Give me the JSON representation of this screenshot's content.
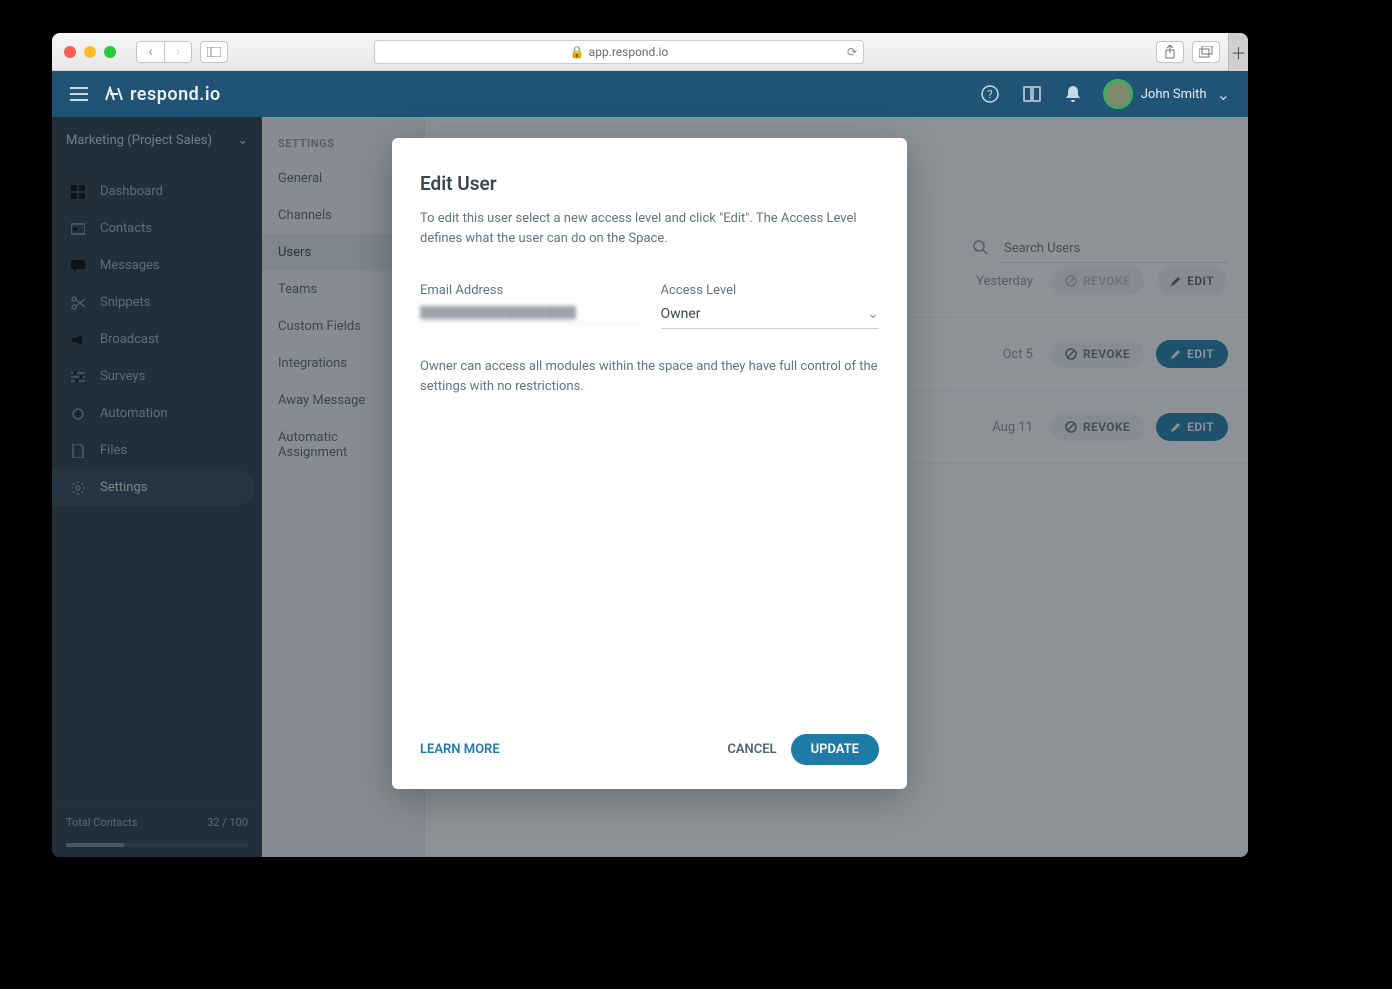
{
  "browser": {
    "url": "app.respond.io"
  },
  "header": {
    "logo_text": "respond.io",
    "user_name": "John Smith"
  },
  "workspace": {
    "name": "Marketing (Project Sales)"
  },
  "nav": {
    "items": [
      {
        "label": "Dashboard",
        "icon": "grid"
      },
      {
        "label": "Contacts",
        "icon": "id"
      },
      {
        "label": "Messages",
        "icon": "chat"
      },
      {
        "label": "Snippets",
        "icon": "scissors"
      },
      {
        "label": "Broadcast",
        "icon": "megaphone"
      },
      {
        "label": "Surveys",
        "icon": "sliders"
      },
      {
        "label": "Automation",
        "icon": "gear-play"
      },
      {
        "label": "Files",
        "icon": "file"
      },
      {
        "label": "Settings",
        "icon": "gear"
      }
    ],
    "active_index": 8
  },
  "footer": {
    "label": "Total Contacts",
    "value": "32 / 100"
  },
  "settings": {
    "heading": "SETTINGS",
    "items": [
      "General",
      "Channels",
      "Users",
      "Teams",
      "Custom Fields",
      "Integrations",
      "Away Message",
      "Automatic Assignment"
    ],
    "active_index": 2
  },
  "users_page": {
    "search_placeholder": "Search Users",
    "rows": [
      {
        "date": "Yesterday",
        "revoke": "REVOKE",
        "edit": "EDIT",
        "editable": false
      },
      {
        "date": "Oct 5",
        "revoke": "REVOKE",
        "edit": "EDIT",
        "editable": true
      },
      {
        "date": "Aug 11",
        "revoke": "REVOKE",
        "edit": "EDIT",
        "editable": true
      }
    ]
  },
  "modal": {
    "title": "Edit User",
    "description": "To edit this user select a new access level and click \"Edit\". The Access Level defines what the user can do on the Space.",
    "email_label": "Email Address",
    "email_value": "████████████████████",
    "access_label": "Access Level",
    "access_value": "Owner",
    "hint": "Owner can access all modules within the space and they have full control of the settings with no restrictions.",
    "learn_more": "LEARN MORE",
    "cancel": "CANCEL",
    "update": "UPDATE"
  }
}
